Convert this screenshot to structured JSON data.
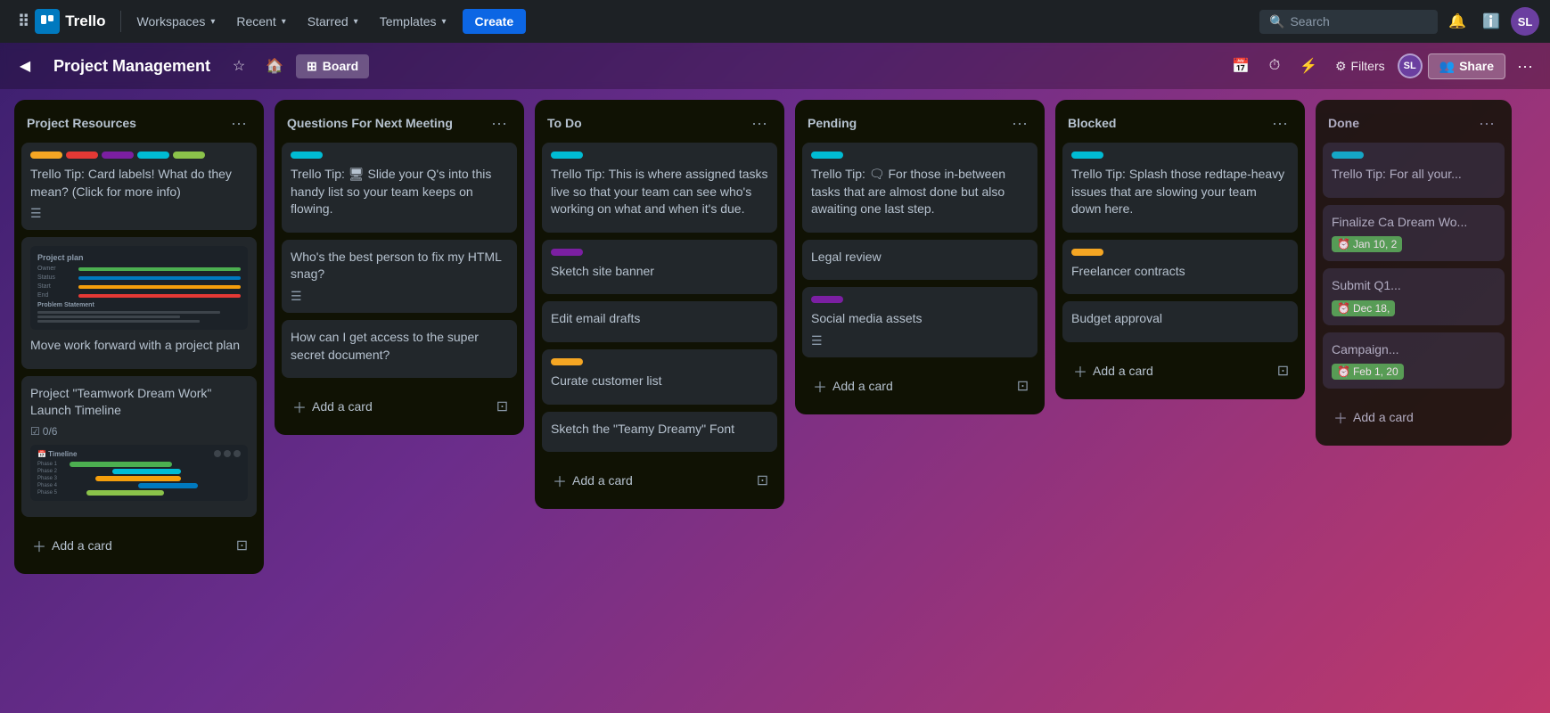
{
  "app": {
    "name": "Trello",
    "logo_text": "Trello"
  },
  "topnav": {
    "workspaces_label": "Workspaces",
    "recent_label": "Recent",
    "starred_label": "Starred",
    "templates_label": "Templates",
    "create_label": "Create",
    "search_placeholder": "Search",
    "user_initials": "SL"
  },
  "boardbar": {
    "title": "Project Management",
    "view_label": "Board",
    "filters_label": "Filters",
    "share_label": "Share",
    "user_initials": "SL"
  },
  "columns": [
    {
      "id": "project-resources",
      "title": "Project Resources",
      "cards": [
        {
          "id": "pr-1",
          "title": "Trello Tip: Card labels! What do they mean? (Click for more info)",
          "labels": [
            "#f5a623",
            "#e53935",
            "#7b1fa2",
            "#00bcd4",
            "#8bc34a"
          ],
          "has_desc": true,
          "thumbnail": null
        },
        {
          "id": "pr-2",
          "title": "Move work forward with a project plan",
          "labels": [],
          "thumbnail": "project-plan"
        },
        {
          "id": "pr-3",
          "title": "Project \"Teamwork Dream Work\" Launch Timeline",
          "labels": [],
          "checklist": "0/6",
          "thumbnail": "timeline"
        }
      ],
      "add_label": "Add a card"
    },
    {
      "id": "questions-next-meeting",
      "title": "Questions For Next Meeting",
      "cards": [
        {
          "id": "qnm-1",
          "title": "Trello Tip: 🖥 Slide your Q's into this handy list so your team keeps on flowing.",
          "labels": [
            "#00bcd4"
          ],
          "has_desc": false
        },
        {
          "id": "qnm-2",
          "title": "Who's the best person to fix my HTML snag?",
          "labels": [],
          "has_desc": true
        },
        {
          "id": "qnm-3",
          "title": "How can I get access to the super secret document?",
          "labels": [],
          "has_desc": false
        }
      ],
      "add_label": "Add a card"
    },
    {
      "id": "to-do",
      "title": "To Do",
      "cards": [
        {
          "id": "td-1",
          "title": "Trello Tip: This is where assigned tasks live so that your team can see who's working on what and when it's due.",
          "labels": [
            "#00bcd4"
          ],
          "has_desc": false
        },
        {
          "id": "td-2",
          "title": "Sketch site banner",
          "labels": [
            "#7b1fa2"
          ],
          "has_desc": false
        },
        {
          "id": "td-3",
          "title": "Edit email drafts",
          "labels": [],
          "has_desc": false
        },
        {
          "id": "td-4",
          "title": "Curate customer list",
          "labels": [
            "#f5a623"
          ],
          "has_desc": false
        },
        {
          "id": "td-5",
          "title": "Sketch the \"Teamy Dreamy\" Font",
          "labels": [],
          "has_desc": false
        }
      ],
      "add_label": "Add a card"
    },
    {
      "id": "pending",
      "title": "Pending",
      "cards": [
        {
          "id": "p-1",
          "title": "Trello Tip: 🗨 For those in-between tasks that are almost done but also awaiting one last step.",
          "labels": [
            "#00bcd4"
          ],
          "has_desc": false
        },
        {
          "id": "p-2",
          "title": "Legal review",
          "labels": [],
          "has_desc": false
        },
        {
          "id": "p-3",
          "title": "Social media assets",
          "labels": [
            "#7b1fa2"
          ],
          "has_desc": true
        }
      ],
      "add_label": "Add a card"
    },
    {
      "id": "blocked",
      "title": "Blocked",
      "cards": [
        {
          "id": "b-1",
          "title": "Trello Tip: Splash those redtape-heavy issues that are slowing your team down here.",
          "labels": [
            "#00bcd4"
          ],
          "has_desc": false
        },
        {
          "id": "b-2",
          "title": "Freelancer contracts",
          "labels": [
            "#f5a623"
          ],
          "has_desc": false
        },
        {
          "id": "b-3",
          "title": "Budget approval",
          "labels": [],
          "has_desc": false
        }
      ],
      "add_label": "Add a card"
    },
    {
      "id": "done",
      "title": "Done",
      "cards": [
        {
          "id": "d-1",
          "title": "Trello Tip: For all your...",
          "labels": [
            "#00bcd4"
          ],
          "truncated": true,
          "has_desc": false
        },
        {
          "id": "d-2",
          "title": "Finalize Ca Dream Wo...",
          "due": "Jan 10, 2",
          "due_color": "green",
          "labels": [],
          "truncated": true
        },
        {
          "id": "d-3",
          "title": "Submit Q1...",
          "due": "Dec 18,",
          "due_color": "green",
          "labels": [],
          "truncated": true
        },
        {
          "id": "d-4",
          "title": "Campaign...",
          "due": "Feb 1, 20",
          "due_color": "green",
          "labels": [],
          "truncated": true
        }
      ],
      "add_label": "Add a card"
    }
  ]
}
